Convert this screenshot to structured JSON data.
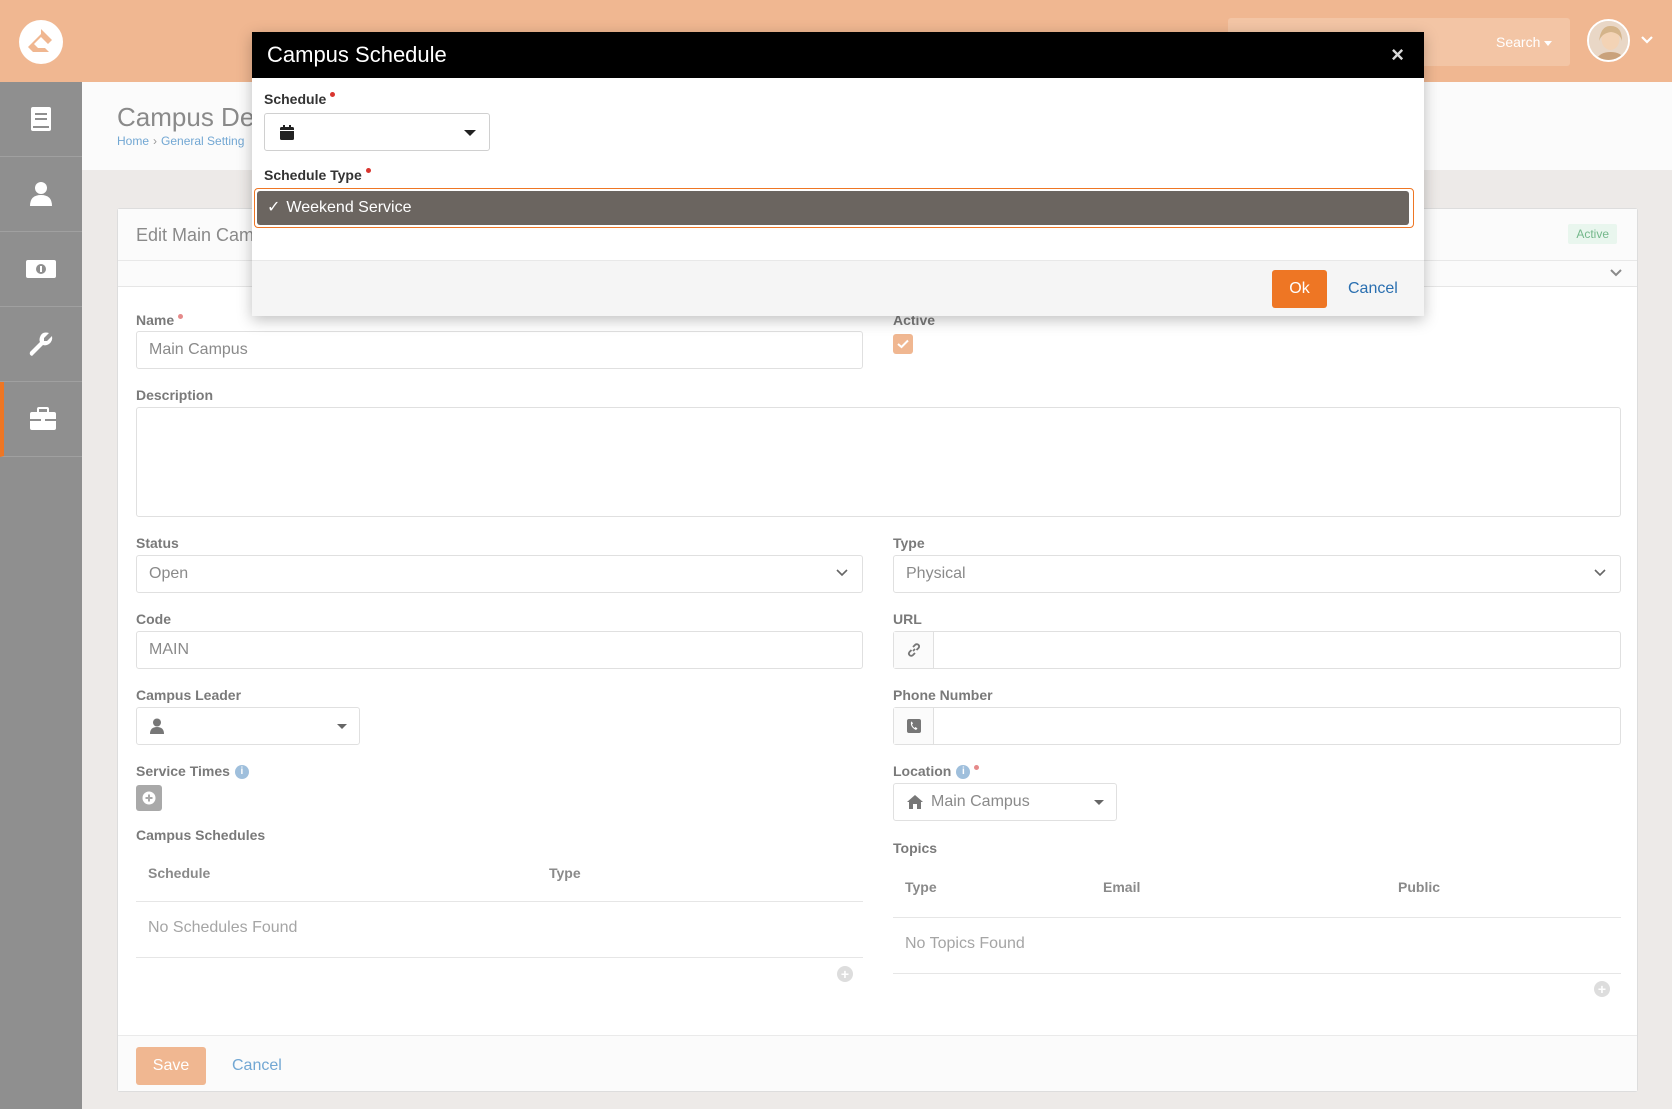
{
  "colors": {
    "brand": "#ee7624",
    "topbar": "#f0b791",
    "link": "#72a7d3",
    "success": "#74b88b"
  },
  "topbar": {
    "search_label": "Search",
    "logo_icon": "rock-logo-icon",
    "user_menu_icon": "chevron-down-icon"
  },
  "sidebar": {
    "items": [
      {
        "icon": "book-icon"
      },
      {
        "icon": "person-icon"
      },
      {
        "icon": "money-icon"
      },
      {
        "icon": "wrench-icon"
      },
      {
        "icon": "briefcase-icon",
        "active": true
      }
    ]
  },
  "page": {
    "title": "Campus De",
    "breadcrumb": [
      "Home",
      "General Setting"
    ]
  },
  "panel": {
    "title": "Edit Main Cam",
    "status_badge": "Active",
    "fields": {
      "name_label": "Name",
      "name_value": "Main Campus",
      "active_label": "Active",
      "description_label": "Description",
      "status_label": "Status",
      "status_value": "Open",
      "type_label": "Type",
      "type_value": "Physical",
      "code_label": "Code",
      "code_value": "MAIN",
      "url_label": "URL",
      "campus_leader_label": "Campus Leader",
      "phone_label": "Phone Number",
      "service_times_label": "Service Times",
      "location_label": "Location",
      "location_value": "Main Campus",
      "campus_schedules_label": "Campus Schedules",
      "topics_label": "Topics"
    },
    "schedules_grid": {
      "columns": [
        "Schedule",
        "Type"
      ],
      "empty": "No Schedules Found"
    },
    "topics_grid": {
      "columns": [
        "Type",
        "Email",
        "Public"
      ],
      "empty": "No Topics Found"
    },
    "footer": {
      "save": "Save",
      "cancel": "Cancel"
    }
  },
  "modal": {
    "title": "Campus Schedule",
    "close": "×",
    "schedule_label": "Schedule",
    "schedule_type_label": "Schedule Type",
    "schedule_type_option": "Weekend Service",
    "check": "✓",
    "ok": "Ok",
    "cancel": "Cancel"
  }
}
